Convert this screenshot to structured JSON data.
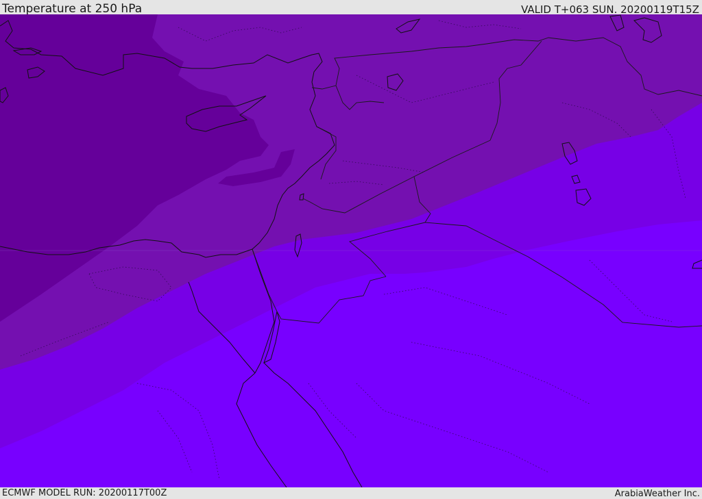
{
  "header": {
    "title": "Temperature at 250 hPa",
    "valid": "VALID T+063 SUN. 20200119T15Z"
  },
  "footer": {
    "model_run": "ECMWF MODEL RUN: 20200117T00Z",
    "credit": "ArabiaWeather Inc."
  },
  "map": {
    "parameter": "Temperature",
    "level": "250 hPa",
    "colors": {
      "darkest": "#65009a",
      "dark": "#7410b0",
      "mid": "#7700e6",
      "light": "#7800ff",
      "coastline": "#111111",
      "border": "#1a1a1a"
    }
  }
}
